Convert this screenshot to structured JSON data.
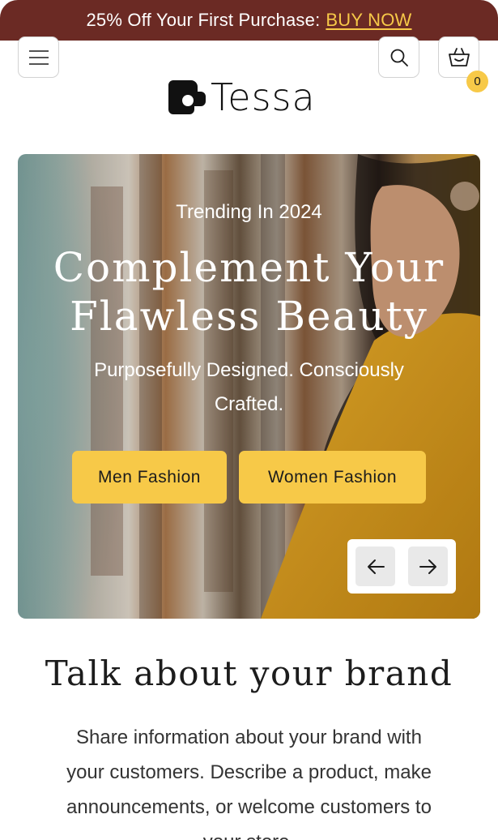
{
  "announcement": {
    "text": "25% Off Your First Purchase:",
    "link_label": "BUY NOW"
  },
  "header": {
    "logo_text": "Tessa",
    "cart_count": "0",
    "icons": [
      "menu-icon",
      "search-icon",
      "cart-icon"
    ]
  },
  "hero": {
    "eyebrow": "Trending In 2024",
    "title": "Complement Your Flawless Beauty",
    "subtitle": "Purposefully Designed. Consciously Crafted.",
    "buttons": [
      "Men Fashion",
      "Women Fashion"
    ],
    "nav_icons": [
      "arrow-left-icon",
      "arrow-right-icon"
    ]
  },
  "brand": {
    "title": "Talk about your brand",
    "text": "Share information about your brand with your customers. Describe a product, make announcements, or welcome customers to your store."
  },
  "colors": {
    "announcement_bg": "#6b2a24",
    "accent": "#f7c948",
    "text": "#1c1c1c"
  }
}
